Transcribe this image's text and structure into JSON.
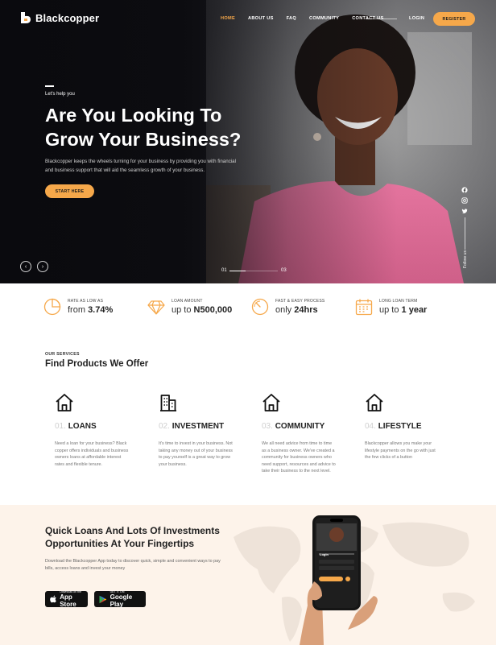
{
  "brand": {
    "name": "Blackcopper",
    "accent": "#f6a84a"
  },
  "nav": {
    "items": [
      {
        "label": "HOME",
        "active": true
      },
      {
        "label": "ABOUT US",
        "active": false
      },
      {
        "label": "FAQ",
        "active": false
      },
      {
        "label": "COMMUNITY",
        "active": false
      },
      {
        "label": "CONTACT US",
        "active": false
      }
    ],
    "login": "LOGIN",
    "register": "REGISTER"
  },
  "hero": {
    "eyebrow": "Let's help you",
    "title_line1": "Are You Looking To",
    "title_line2": "Grow Your Business?",
    "description": "Blackcopper keeps the wheels turning for your business by providing you with financial and business support that will aid the seamless growth of your business.",
    "cta": "START HERE",
    "slide_start": "01",
    "slide_end": "03",
    "slide_progress": 0.33,
    "prev_icon": "‹",
    "next_icon": "›",
    "follow": "Follow us"
  },
  "stats": [
    {
      "label": "RATE AS LOW AS",
      "prefix": "from ",
      "value": "3.74%",
      "icon": "pie-chart-icon"
    },
    {
      "label": "LOAN AMOUNT",
      "prefix": "up to ",
      "value": "N500,000",
      "icon": "diamond-icon"
    },
    {
      "label": "FAST & EASY PROCESS",
      "prefix": "only ",
      "value": "24hrs",
      "icon": "speedometer-icon"
    },
    {
      "label": "LONG LOAN TERM",
      "prefix": "up to ",
      "value": "1 year",
      "icon": "calendar-icon"
    }
  ],
  "services": {
    "eyebrow": "OUR SERVICES",
    "title": "Find Products We Offer",
    "items": [
      {
        "num": "01.",
        "name": "LOANS",
        "icon": "home-icon",
        "description": "Need a loan for your business? Black copper offers individuals and business owners loans at affordable interest rates and flexible tenure."
      },
      {
        "num": "02.",
        "name": "INVESTMENT",
        "icon": "building-icon",
        "description": "It's time to invest in your business. Not taking any money out of your business to pay yourself is a great way to grow your business."
      },
      {
        "num": "03.",
        "name": "COMMUNITY",
        "icon": "home-icon",
        "description": "We all need advice from time to time as a business owner. We've created a community for business owners who need support, resources and advice to take their business to the next level."
      },
      {
        "num": "04.",
        "name": "LIFESTYLE",
        "icon": "home-icon",
        "description": "Blackcopper allows you make your lifestyle payments on the go with just the few clicks of a button"
      }
    ]
  },
  "app_banner": {
    "title_line1": "Quick Loans And Lots Of Investments",
    "title_line2": "Opportunities At Your Fingertips",
    "description": "Download the Blackcopper App today to discover quick, simple and convenient ways to pay bills, access loans and invest your money",
    "appstore_small": "Download on the",
    "appstore_big": "App Store",
    "gplay_small": "GET IT ON",
    "gplay_big": "Google Play",
    "phone_login": "Login"
  }
}
